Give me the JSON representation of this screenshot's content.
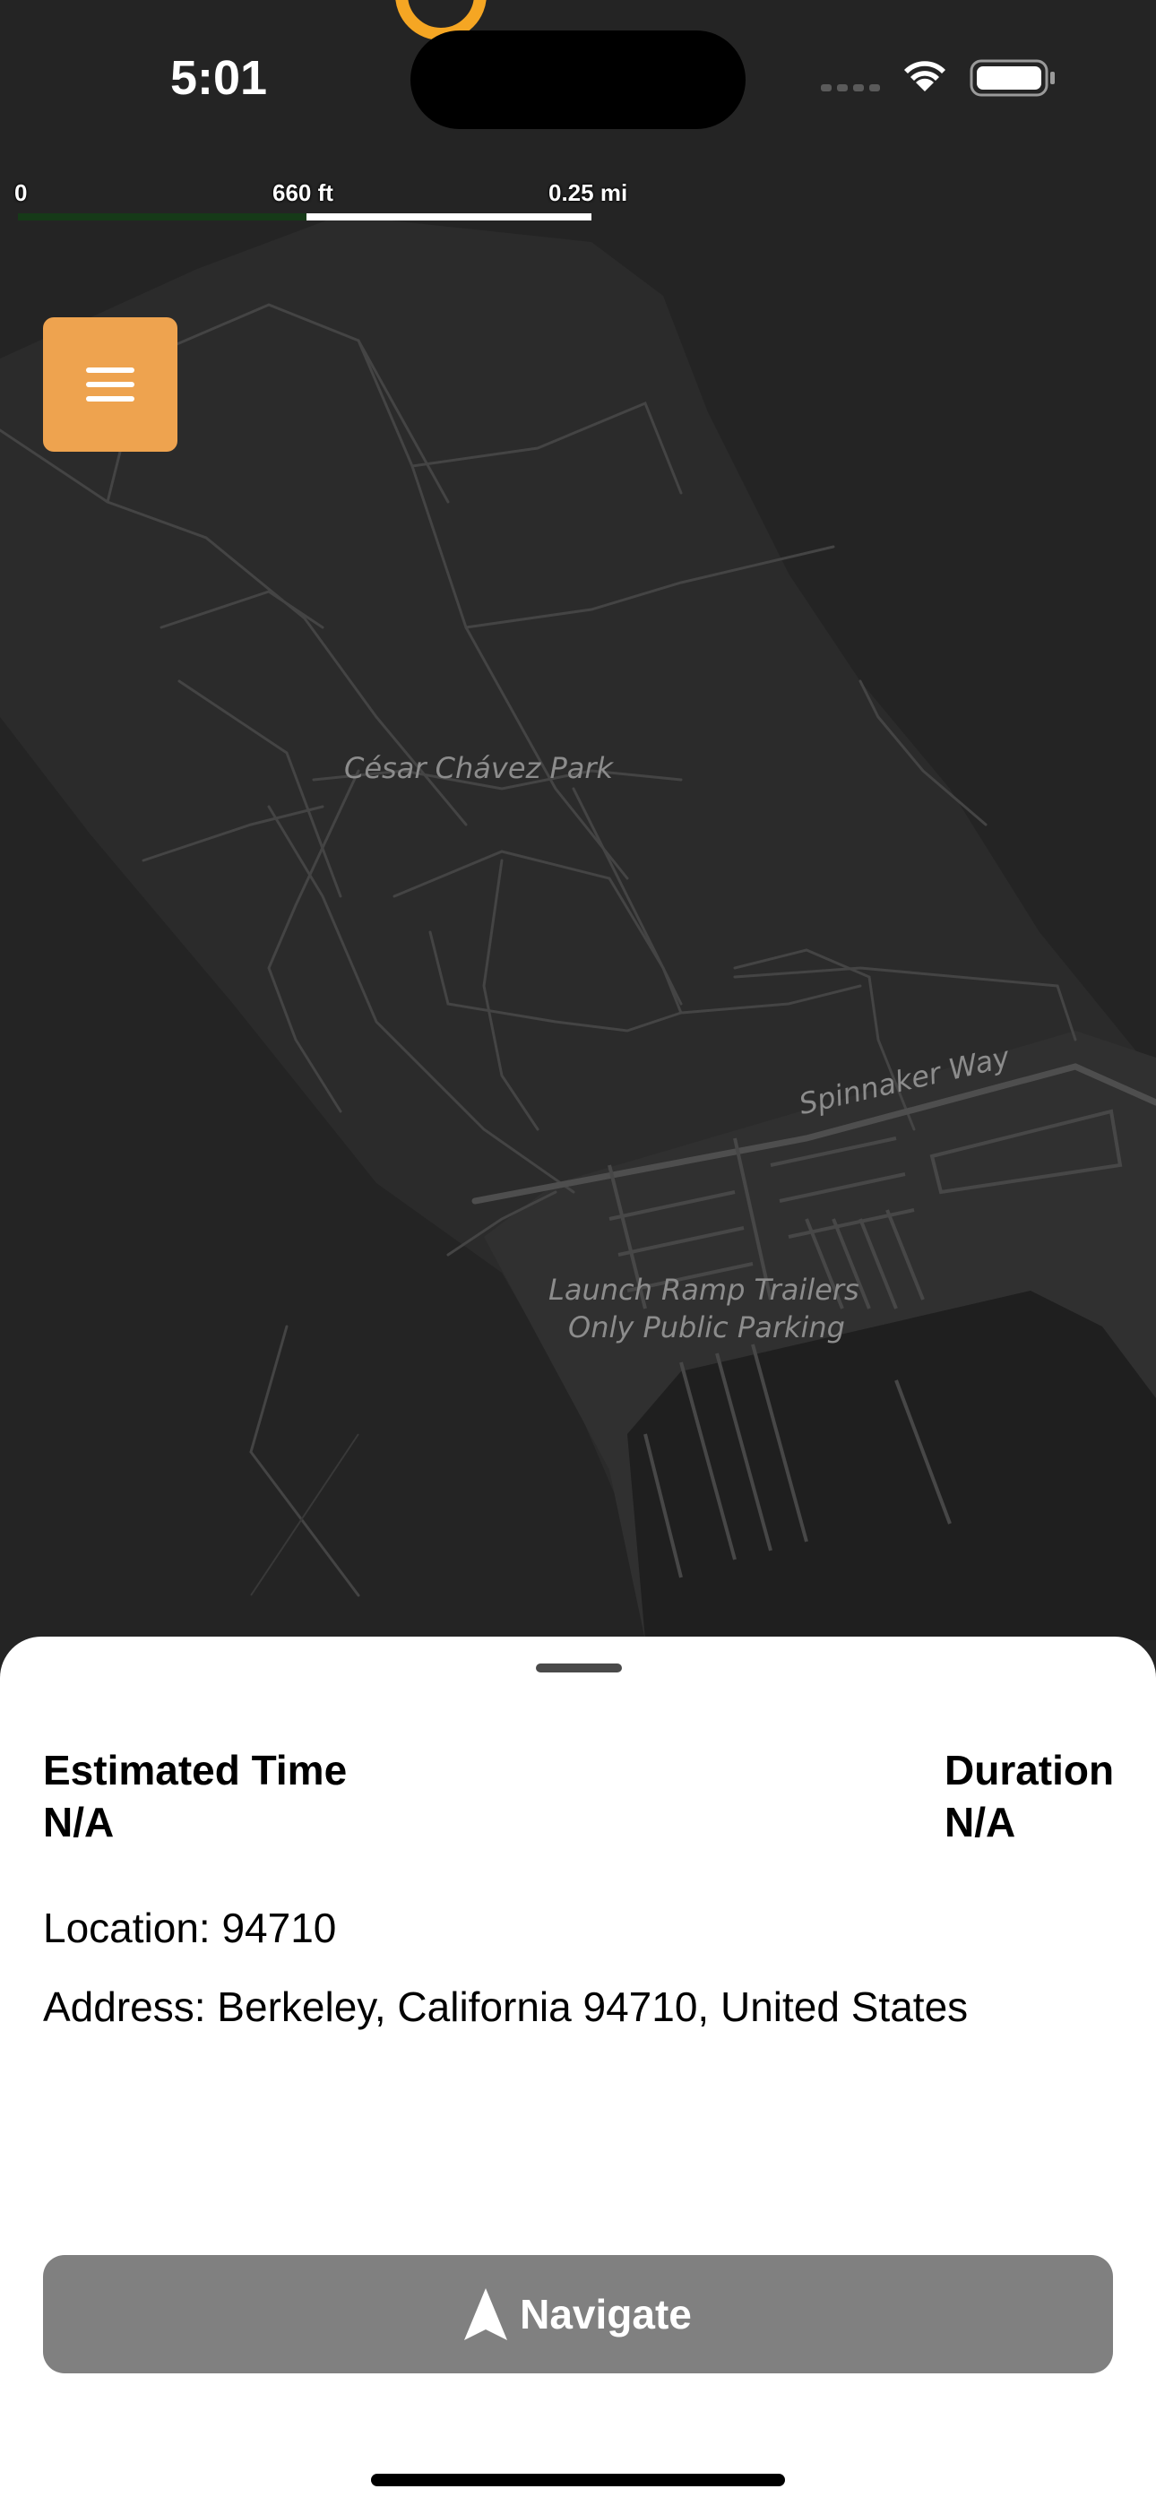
{
  "status_bar": {
    "time": "5:01"
  },
  "map": {
    "scale": {
      "start": "0",
      "mid": "660 ft",
      "end": "0.25 mi"
    },
    "labels": {
      "park": "César Chávez Park",
      "street": "Spinnaker Way",
      "parking_line1": "Launch Ramp Trailers",
      "parking_line2": "Only Public Parking"
    }
  },
  "menu_button": {
    "icon": "hamburger-menu-icon"
  },
  "sheet": {
    "estimated_time_label": "Estimated Time",
    "estimated_time_value": "N/A",
    "duration_label": "Duration",
    "duration_value": "N/A",
    "location": "Location: 94710",
    "address": "Address: Berkeley, California 94710, United States",
    "navigate_label": "Navigate",
    "navigate_icon": "navigation-arrow-icon"
  },
  "colors": {
    "accent": "#eea34f",
    "button_disabled": "#808080",
    "map_bg": "#242424",
    "pin": "#f5a623"
  }
}
